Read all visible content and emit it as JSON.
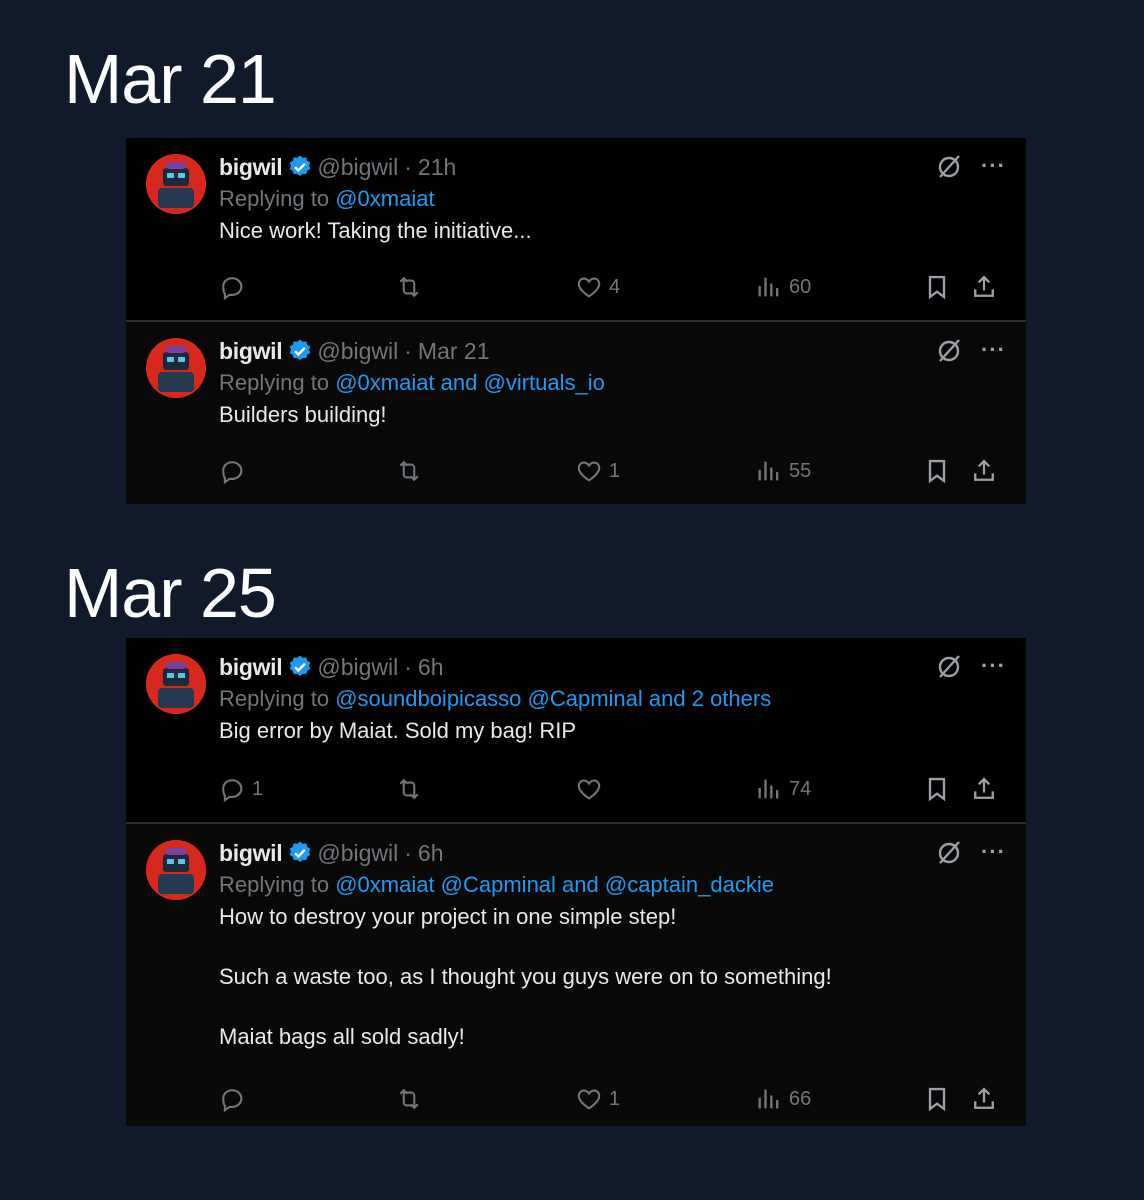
{
  "sections": [
    {
      "date": "Mar 21",
      "tweets": [
        {
          "name": "bigwil",
          "handle": "@bigwil",
          "time": "21h",
          "replying_prefix": "Replying to ",
          "replying_links": "@0xmaiat",
          "text": "Nice work! Taking the initiative...",
          "replies": "",
          "likes": "4",
          "views": "60"
        },
        {
          "name": "bigwil",
          "handle": "@bigwil",
          "time": "Mar 21",
          "replying_prefix": "Replying to ",
          "replying_links": "@0xmaiat and @virtuals_io",
          "text": "Builders building!",
          "replies": "",
          "likes": "1",
          "views": "55"
        }
      ]
    },
    {
      "date": "Mar 25",
      "tweets": [
        {
          "name": "bigwil",
          "handle": "@bigwil",
          "time": "6h",
          "replying_prefix": "Replying to ",
          "replying_links": "@soundboipicasso @Capminal and 2 others",
          "text": "Big error by Maiat. Sold my bag! RIP",
          "replies": "1",
          "likes": "",
          "views": "74"
        },
        {
          "name": "bigwil",
          "handle": "@bigwil",
          "time": "6h",
          "replying_prefix": "Replying to ",
          "replying_links": "@0xmaiat @Capminal and @captain_dackie",
          "text": "How to destroy your project in one simple step!\n\nSuch a waste too, as I thought you guys were on to something!\n\nMaiat bags all sold sadly!",
          "replies": "",
          "likes": "1",
          "views": "66"
        }
      ]
    }
  ],
  "ui": {
    "separator_dot": "·",
    "more_glyph": "···"
  },
  "colors": {
    "page_bg": "#111a2b",
    "card_bg": "#000000",
    "link": "#1d9bf0",
    "muted": "#71767b",
    "text": "#e7e9ea",
    "verified": "#1d9bf0",
    "avatar_bg": "#d7281c"
  },
  "icons": [
    "verified-badge-icon",
    "grok-icon",
    "more-icon",
    "reply-icon",
    "retweet-icon",
    "like-icon",
    "views-icon",
    "bookmark-icon",
    "share-icon"
  ]
}
